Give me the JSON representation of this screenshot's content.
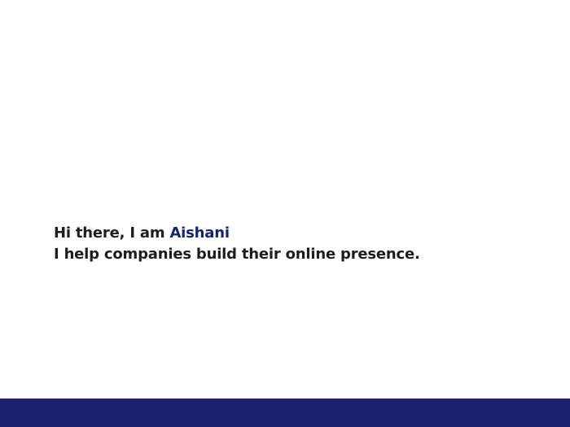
{
  "hero": {
    "greeting": "Hi there, I am ",
    "name": "Aishani",
    "tagline": "I help companies build their online presence."
  },
  "colors": {
    "accent": "#1a2270",
    "text": "#1d1d1f",
    "background": "#ffffff"
  }
}
